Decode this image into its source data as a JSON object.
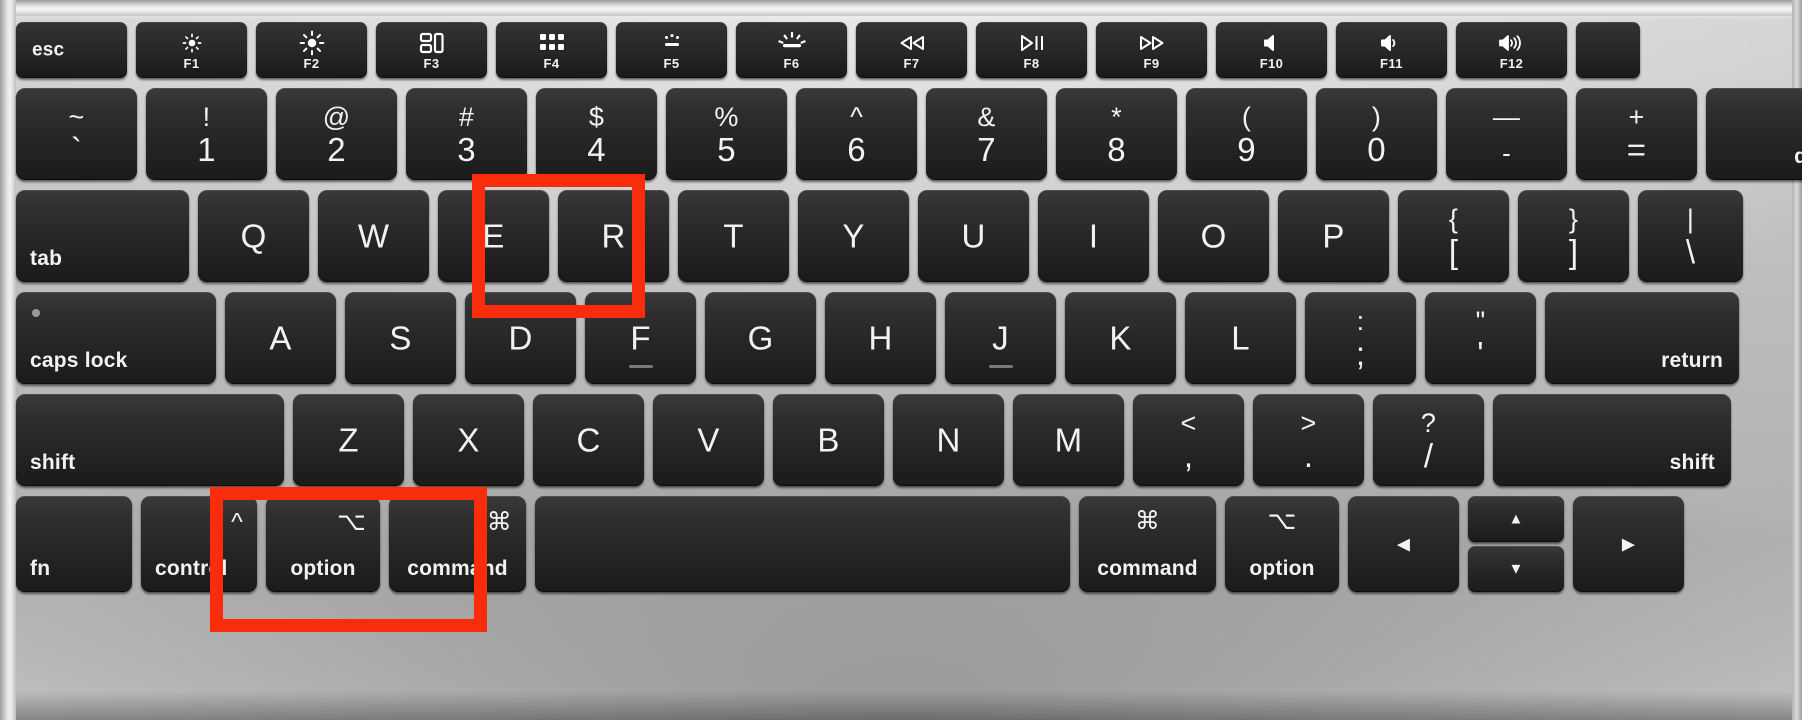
{
  "scene": {
    "title": "MacBook keyboard with highlighted shortcut keys",
    "highlight_color": "#f92c0c",
    "key_color": "#262626",
    "chassis_color": "#bdbdbd",
    "legend_color": "#f2f2f2"
  },
  "function_row": [
    {
      "name": "esc",
      "label": "esc",
      "style": "word-left"
    },
    {
      "name": "f1",
      "fkey": "F1",
      "icon": "brightness-down-icon"
    },
    {
      "name": "f2",
      "fkey": "F2",
      "icon": "brightness-up-icon"
    },
    {
      "name": "f3",
      "fkey": "F3",
      "icon": "mission-control-icon"
    },
    {
      "name": "f4",
      "fkey": "F4",
      "icon": "launchpad-icon"
    },
    {
      "name": "f5",
      "fkey": "F5",
      "icon": "keyboard-brightness-down-icon"
    },
    {
      "name": "f6",
      "fkey": "F6",
      "icon": "keyboard-brightness-up-icon"
    },
    {
      "name": "f7",
      "fkey": "F7",
      "icon": "rewind-icon"
    },
    {
      "name": "f8",
      "fkey": "F8",
      "icon": "play-pause-icon"
    },
    {
      "name": "f9",
      "fkey": "F9",
      "icon": "fast-forward-icon"
    },
    {
      "name": "f10",
      "fkey": "F10",
      "icon": "mute-icon"
    },
    {
      "name": "f11",
      "fkey": "F11",
      "icon": "volume-down-icon"
    },
    {
      "name": "f12",
      "fkey": "F12",
      "icon": "volume-up-icon"
    },
    {
      "name": "power",
      "label": "",
      "icon": "power-touchid-icon"
    }
  ],
  "number_row": [
    {
      "name": "grave",
      "top": "~",
      "bottom": "`"
    },
    {
      "name": "one",
      "top": "!",
      "bottom": "1"
    },
    {
      "name": "two",
      "top": "@",
      "bottom": "2"
    },
    {
      "name": "three",
      "top": "#",
      "bottom": "3"
    },
    {
      "name": "four",
      "top": "$",
      "bottom": "4"
    },
    {
      "name": "five",
      "top": "%",
      "bottom": "5"
    },
    {
      "name": "six",
      "top": "^",
      "bottom": "6"
    },
    {
      "name": "seven",
      "top": "&",
      "bottom": "7"
    },
    {
      "name": "eight",
      "top": "*",
      "bottom": "8"
    },
    {
      "name": "nine",
      "top": "(",
      "bottom": "9"
    },
    {
      "name": "zero",
      "top": ")",
      "bottom": "0"
    },
    {
      "name": "minus",
      "top": "—",
      "bottom": "-"
    },
    {
      "name": "equal",
      "top": "+",
      "bottom": "="
    },
    {
      "name": "delete",
      "label": "delete"
    }
  ],
  "top_row": [
    {
      "name": "tab",
      "label": "tab"
    },
    {
      "name": "q",
      "letter": "Q"
    },
    {
      "name": "w",
      "letter": "W"
    },
    {
      "name": "e",
      "letter": "E"
    },
    {
      "name": "r",
      "letter": "R",
      "highlighted": true
    },
    {
      "name": "t",
      "letter": "T"
    },
    {
      "name": "y",
      "letter": "Y"
    },
    {
      "name": "u",
      "letter": "U"
    },
    {
      "name": "i",
      "letter": "I"
    },
    {
      "name": "o",
      "letter": "O"
    },
    {
      "name": "p",
      "letter": "P"
    },
    {
      "name": "bracket-left",
      "top": "{",
      "bottom": "["
    },
    {
      "name": "bracket-right",
      "top": "}",
      "bottom": "]"
    },
    {
      "name": "backslash",
      "top": "|",
      "bottom": "\\"
    }
  ],
  "home_row": [
    {
      "name": "caps-lock",
      "label": "caps lock"
    },
    {
      "name": "a",
      "letter": "A"
    },
    {
      "name": "s",
      "letter": "S"
    },
    {
      "name": "d",
      "letter": "D"
    },
    {
      "name": "f",
      "letter": "F",
      "bump": true
    },
    {
      "name": "g",
      "letter": "G"
    },
    {
      "name": "h",
      "letter": "H"
    },
    {
      "name": "j",
      "letter": "J",
      "bump": true
    },
    {
      "name": "k",
      "letter": "K"
    },
    {
      "name": "l",
      "letter": "L"
    },
    {
      "name": "semicolon",
      "top": ":",
      "bottom": ";"
    },
    {
      "name": "quote",
      "top": "\"",
      "bottom": "'"
    },
    {
      "name": "return",
      "label": "return"
    }
  ],
  "bottom_row": [
    {
      "name": "shift-left",
      "label": "shift"
    },
    {
      "name": "z",
      "letter": "Z"
    },
    {
      "name": "x",
      "letter": "X"
    },
    {
      "name": "c",
      "letter": "C"
    },
    {
      "name": "v",
      "letter": "V"
    },
    {
      "name": "b",
      "letter": "B"
    },
    {
      "name": "n",
      "letter": "N"
    },
    {
      "name": "m",
      "letter": "M"
    },
    {
      "name": "comma",
      "top": "<",
      "bottom": ","
    },
    {
      "name": "period",
      "top": ">",
      "bottom": "."
    },
    {
      "name": "slash",
      "top": "?",
      "bottom": "/"
    },
    {
      "name": "shift-right",
      "label": "shift"
    }
  ],
  "modifier_row": [
    {
      "name": "fn",
      "label": "fn"
    },
    {
      "name": "control",
      "label": "control",
      "symbol": "^"
    },
    {
      "name": "option-left",
      "label": "option",
      "symbol": "⌥",
      "highlighted": true
    },
    {
      "name": "command-left",
      "label": "command",
      "symbol": "⌘",
      "highlighted": true
    },
    {
      "name": "space",
      "label": ""
    },
    {
      "name": "command-right",
      "label": "command",
      "symbol": "⌘"
    },
    {
      "name": "option-right",
      "label": "option",
      "symbol": "⌥"
    },
    {
      "name": "arrow-left",
      "glyph": "◀"
    },
    {
      "name": "arrow-up",
      "glyph": "▲"
    },
    {
      "name": "arrow-down",
      "glyph": "▼"
    },
    {
      "name": "arrow-right",
      "glyph": "▶"
    }
  ],
  "highlights": [
    {
      "name": "highlight-box-r",
      "keys": "R"
    },
    {
      "name": "highlight-box-option-command",
      "keys": "option + command"
    }
  ]
}
